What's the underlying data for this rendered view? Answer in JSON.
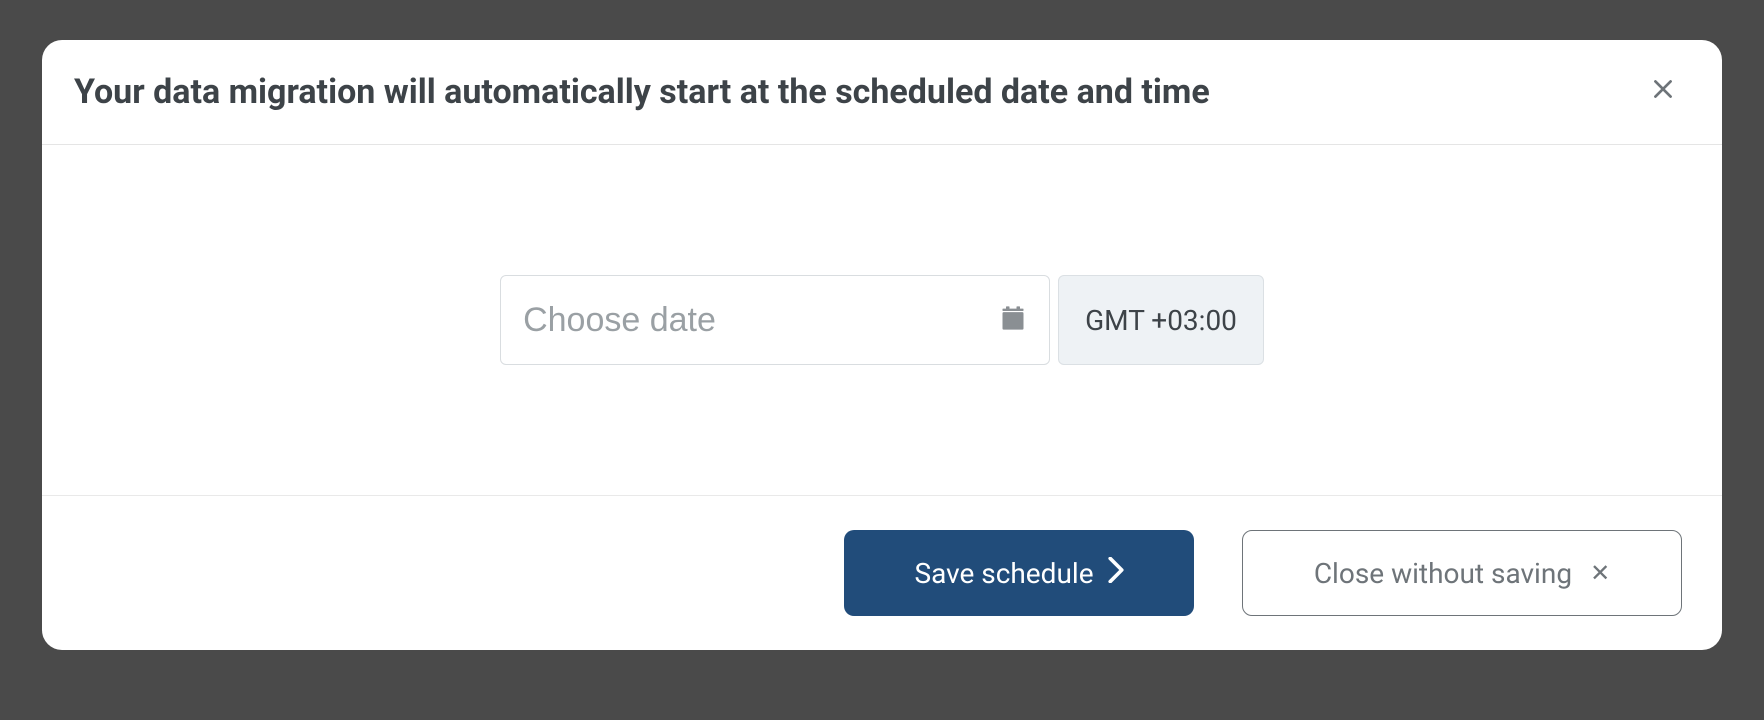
{
  "modal": {
    "title": "Your data migration will automatically start at the scheduled date and time",
    "dateInput": {
      "placeholder": "Choose date",
      "value": ""
    },
    "timezone": "GMT +03:00",
    "buttons": {
      "save": "Save schedule",
      "close": "Close without saving"
    }
  }
}
